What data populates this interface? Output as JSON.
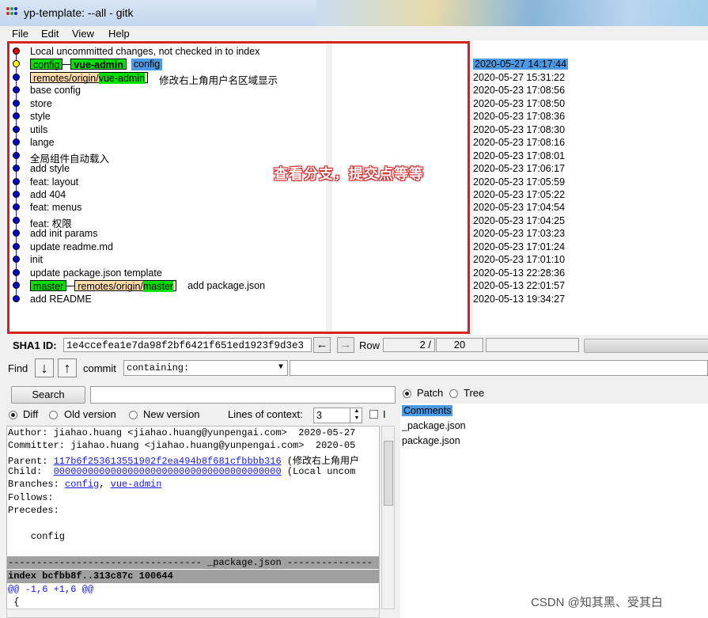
{
  "window": {
    "title": "yp-template: --all - gitk"
  },
  "menu": [
    "File",
    "Edit",
    "View",
    "Help"
  ],
  "commits": [
    {
      "subject": "Local uncommitted changes, not checked in to index",
      "date": "",
      "dot": "#e00000",
      "refs": []
    },
    {
      "subject": "",
      "date": "2020-05-27 14:17:44",
      "dot": "#ffff00",
      "selected": true,
      "refs": [
        {
          "type": "local",
          "name": "config"
        },
        {
          "type": "local-bold",
          "name": "vue-admin"
        },
        {
          "type": "selected",
          "name": "config"
        }
      ]
    },
    {
      "subject": "修改右上角用户名区域显示",
      "date": "2020-05-27 15:31:22",
      "dot": "#0000cc",
      "refs": [
        {
          "type": "remote",
          "prefix": "remotes/origin/",
          "name": "vue-admin"
        }
      ]
    },
    {
      "subject": "base config",
      "date": "2020-05-23 17:08:56",
      "dot": "#0000cc",
      "refs": []
    },
    {
      "subject": "store",
      "date": "2020-05-23 17:08:50",
      "dot": "#0000cc",
      "refs": []
    },
    {
      "subject": "style",
      "date": "2020-05-23 17:08:36",
      "dot": "#0000cc",
      "refs": []
    },
    {
      "subject": "utils",
      "date": "2020-05-23 17:08:30",
      "dot": "#0000cc",
      "refs": []
    },
    {
      "subject": "lange",
      "date": "2020-05-23 17:08:16",
      "dot": "#0000cc",
      "refs": []
    },
    {
      "subject": "全局组件自动载入",
      "date": "2020-05-23 17:08:01",
      "dot": "#0000cc",
      "refs": []
    },
    {
      "subject": "add style",
      "date": "2020-05-23 17:06:17",
      "dot": "#0000cc",
      "refs": []
    },
    {
      "subject": "feat: layout",
      "date": "2020-05-23 17:05:59",
      "dot": "#0000cc",
      "refs": []
    },
    {
      "subject": "add 404",
      "date": "2020-05-23 17:05:22",
      "dot": "#0000cc",
      "refs": []
    },
    {
      "subject": "feat: menus",
      "date": "2020-05-23 17:04:54",
      "dot": "#0000cc",
      "refs": []
    },
    {
      "subject": "feat: 权限",
      "date": "2020-05-23 17:04:25",
      "dot": "#0000cc",
      "refs": []
    },
    {
      "subject": "add init params",
      "date": "2020-05-23 17:03:23",
      "dot": "#0000cc",
      "refs": []
    },
    {
      "subject": "update readme.md",
      "date": "2020-05-23 17:01:24",
      "dot": "#0000cc",
      "refs": []
    },
    {
      "subject": "init",
      "date": "2020-05-23 17:01:10",
      "dot": "#0000cc",
      "refs": []
    },
    {
      "subject": "update package.json template",
      "date": "2020-05-13 22:28:36",
      "dot": "#0000cc",
      "refs": []
    },
    {
      "subject": "add package.json",
      "date": "2020-05-13 22:01:57",
      "dot": "#0000cc",
      "refs": [
        {
          "type": "local",
          "name": "master"
        },
        {
          "type": "remote",
          "prefix": "remotes/origin/",
          "name": "master"
        }
      ]
    },
    {
      "subject": "add README",
      "date": "2020-05-13 19:34:27",
      "dot": "#0000cc",
      "refs": []
    }
  ],
  "annotation": "查看分支，提交点等等",
  "sha": {
    "label": "SHA1 ID:",
    "value": "1e4ccefea1e7da98f2bf6421f651ed1923f9d3e3"
  },
  "row": {
    "label": "Row",
    "current": "2 /",
    "total": "20"
  },
  "find": {
    "label": "Find",
    "commit_label": "commit",
    "type": "containing:",
    "value": ""
  },
  "search": {
    "button": "Search",
    "value": ""
  },
  "diff_options": {
    "diff": "Diff",
    "old": "Old version",
    "new": "New version",
    "ctx_label": "Lines of context:",
    "ctx_value": "3",
    "ignore_cut": "I"
  },
  "right_options": {
    "patch": "Patch",
    "tree": "Tree"
  },
  "diff": {
    "author": "Author: jiahao.huang <jiahao.huang@yunpengai.com>  2020-05-27",
    "committer": "Committer: jiahao.huang <jiahao.huang@yunpengai.com>  2020-05",
    "parent_label": "Parent: ",
    "parent_sha": "117b6f253613551902f2ea494b8f681cfbbbb316",
    "parent_rest": " (修改右上角用户",
    "child_label": "Child:  ",
    "child_sha": "0000000000000000000000000000000000000000",
    "child_rest": " (Local uncom",
    "branches_label": "Branches: ",
    "branch1": "config",
    "branch_sep": ", ",
    "branch2": "vue-admin",
    "follows": "Follows:",
    "precedes": "Precedes:",
    "message": "    config",
    "file_sep": "---------------------------------- _package.json ---------------",
    "index": "index bcfbb8f..313c87c 100644",
    "hunk": "@@ -1,6 +1,6 @@",
    "next": " {"
  },
  "files": [
    "Comments",
    "_package.json",
    "package.json"
  ],
  "watermark": "CSDN @知其黑、受其白"
}
